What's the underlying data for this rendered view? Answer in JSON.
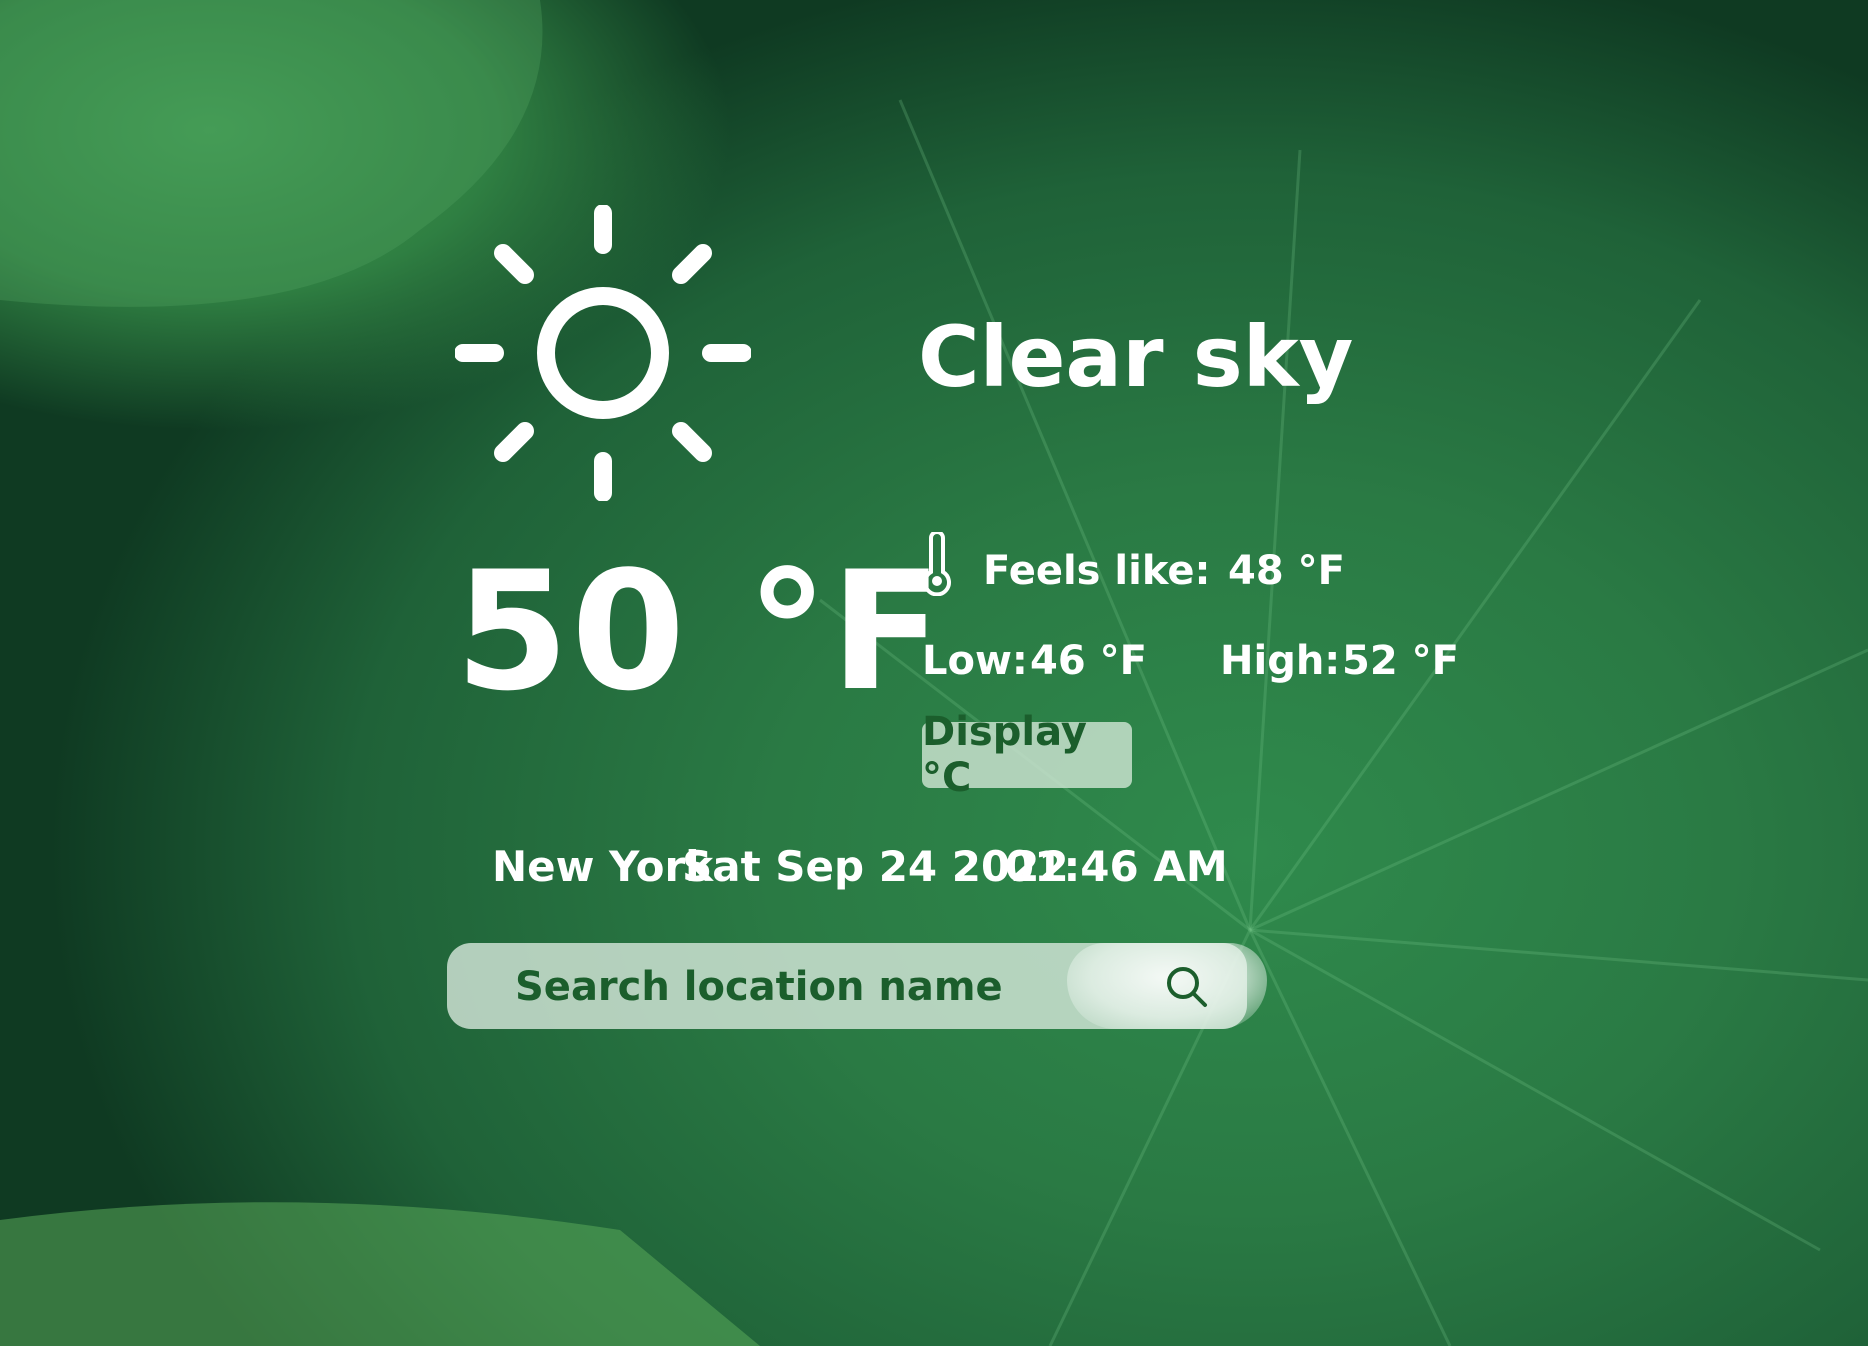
{
  "weather": {
    "icon": "sun-icon",
    "temperature": "50 °F",
    "condition": "Clear sky",
    "feels_like_label": "Feels like:",
    "feels_like_value": "48 °F",
    "low_label": "Low:",
    "low_value": "46 °F",
    "high_label": "High:",
    "high_value": "52 °F",
    "toggle_unit_label": "Display °C"
  },
  "location": {
    "city": "New York",
    "date": "Sat Sep 24 2022",
    "time": "01:46 AM"
  },
  "search": {
    "placeholder": "Search location name",
    "value": ""
  },
  "colors": {
    "text": "#ffffff",
    "accent": "#1b5e2c",
    "button_bg": "#cde4d2"
  }
}
